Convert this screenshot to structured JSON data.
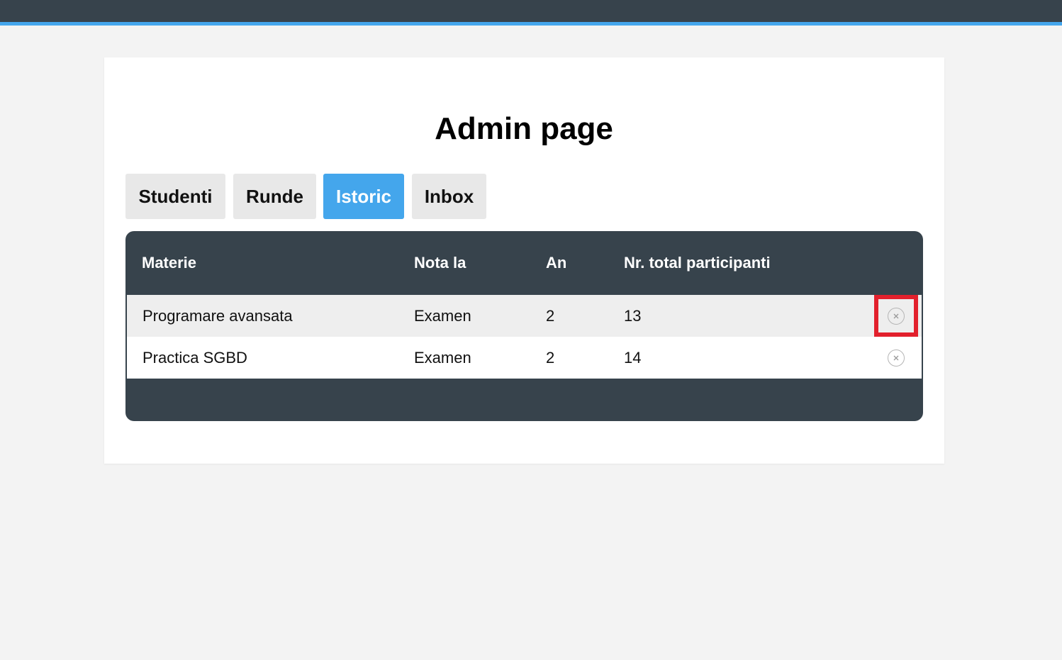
{
  "header": {
    "title": "Admin page"
  },
  "tabs": [
    {
      "label": "Studenti",
      "active": false
    },
    {
      "label": "Runde",
      "active": false
    },
    {
      "label": "Istoric",
      "active": true
    },
    {
      "label": "Inbox",
      "active": false
    }
  ],
  "table": {
    "columns": [
      "Materie",
      "Nota la",
      "An",
      "Nr. total participanti"
    ],
    "rows": [
      {
        "materie": "Programare avansata",
        "nota_la": "Examen",
        "an": "2",
        "participanti": "13"
      },
      {
        "materie": "Practica SGBD",
        "nota_la": "Examen",
        "an": "2",
        "participanti": "14"
      }
    ],
    "delete_icon": "close-circle-icon"
  },
  "colors": {
    "topbar": "#37434c",
    "accent": "#44a6ec",
    "highlight": "#e2202c"
  }
}
